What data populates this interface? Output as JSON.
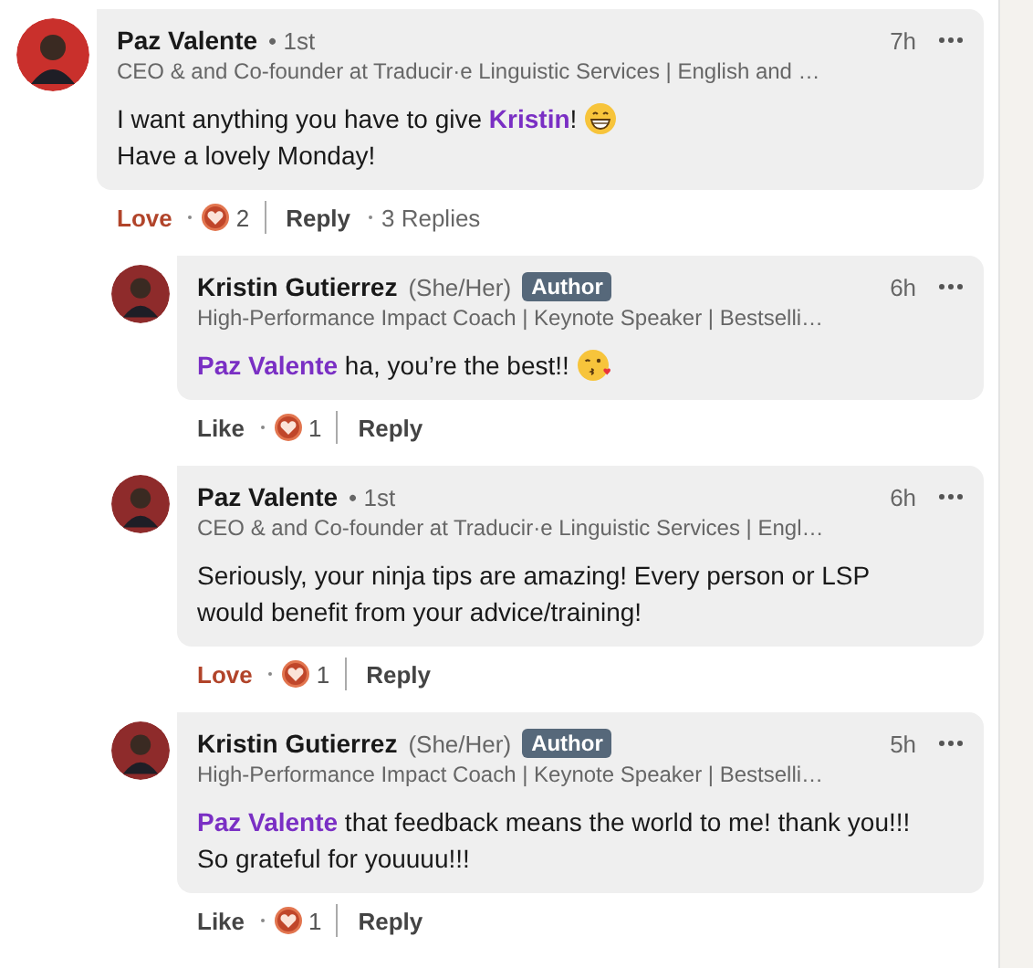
{
  "comments": [
    {
      "name": "Paz Valente",
      "degree": "• 1st",
      "headline": "CEO & and Co-founder at Traducir·e Linguistic Services | English and …",
      "time": "7h",
      "lines": [
        [
          {
            "kind": "text",
            "text": "I want anything you have to give "
          },
          {
            "kind": "mention",
            "text": "Kristin"
          },
          {
            "kind": "text",
            "text": "!"
          },
          {
            "kind": "grin-emoji"
          }
        ],
        [
          {
            "kind": "text",
            "text": "Have a lovely Monday!"
          }
        ]
      ],
      "reaction": {
        "label": "Love",
        "active": true
      },
      "count": "2",
      "reply": "Reply",
      "replies_count": "3 Replies",
      "replies": [
        {
          "name": "Kristin Gutierrez",
          "pronouns": "(She/Her)",
          "badge": "Author",
          "headline": "High-Performance Impact Coach | Keynote Speaker | Bestselli…",
          "time": "6h",
          "lines": [
            [
              {
                "kind": "mention",
                "text": "Paz Valente"
              },
              {
                "kind": "text",
                "text": " ha, you’re the best!!"
              },
              {
                "kind": "kiss-emoji"
              }
            ]
          ],
          "reaction": {
            "label": "Like",
            "active": false
          },
          "count": "1",
          "reply": "Reply"
        },
        {
          "name": "Paz Valente",
          "degree": "• 1st",
          "headline": "CEO & and Co-founder at Traducir·e Linguistic Services | Engl…",
          "time": "6h",
          "lines": [
            [
              {
                "kind": "text",
                "text": "Seriously, your ninja tips are amazing! Every person or LSP"
              }
            ],
            [
              {
                "kind": "text",
                "text": "would benefit from your advice/training!"
              }
            ]
          ],
          "reaction": {
            "label": "Love",
            "active": true
          },
          "count": "1",
          "reply": "Reply"
        },
        {
          "name": "Kristin Gutierrez",
          "pronouns": "(She/Her)",
          "badge": "Author",
          "headline": "High-Performance Impact Coach | Keynote Speaker | Bestselli…",
          "time": "5h",
          "lines": [
            [
              {
                "kind": "mention",
                "text": "Paz Valente"
              },
              {
                "kind": "text",
                "text": " that feedback means the world to me! thank you!!!"
              }
            ],
            [
              {
                "kind": "text",
                "text": "So grateful for youuuu!!!"
              }
            ]
          ],
          "reaction": {
            "label": "Like",
            "active": false
          },
          "count": "1",
          "reply": "Reply"
        }
      ]
    }
  ]
}
